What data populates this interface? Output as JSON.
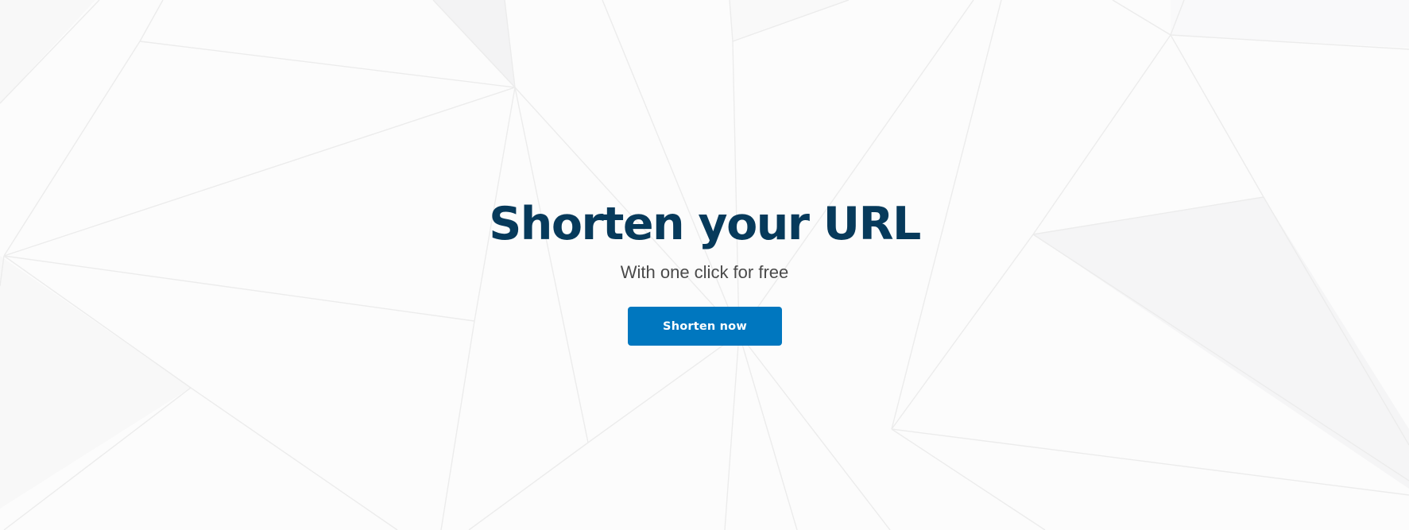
{
  "hero": {
    "title": "Shorten your URL",
    "subtitle": "With one click for free",
    "button_label": "Shorten now"
  },
  "colors": {
    "title": "#073a5b",
    "subtitle": "#4a4a4a",
    "button_bg": "#0077bf",
    "button_text": "#ffffff",
    "background": "#fcfcfc",
    "pattern_lines": "#ececec"
  }
}
